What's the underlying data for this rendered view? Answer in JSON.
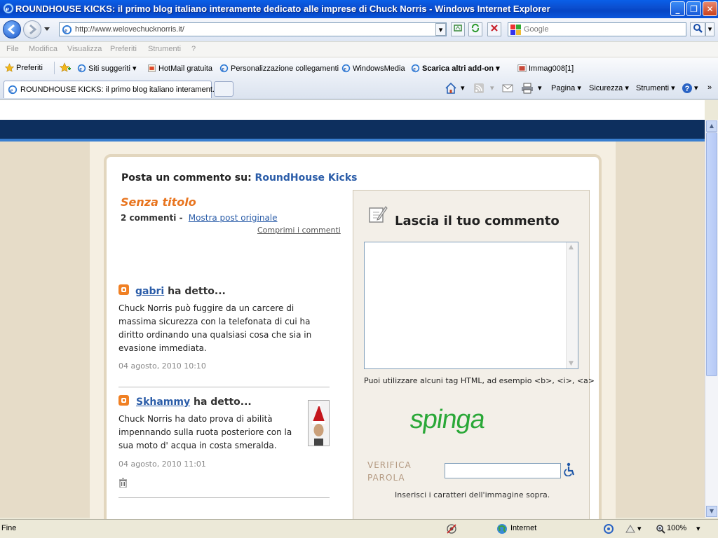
{
  "window": {
    "title": "ROUNDHOUSE KICKS: il primo blog italiano interamente dedicato alle imprese di Chuck Norris - Windows Internet Explorer",
    "minimize": "_",
    "maximize": "❐",
    "close": "✕"
  },
  "address": {
    "url": "http://www.welovechucknorris.it/",
    "search_placeholder": "Google"
  },
  "menu": [
    "File",
    "Modifica",
    "Visualizza",
    "Preferiti",
    "Strumenti",
    "?"
  ],
  "favorites": {
    "label": "Preferiti",
    "items": [
      "Siti suggeriti",
      "HotMail gratuita",
      "Personalizzazione collegamenti",
      "WindowsMedia",
      "Scarica altri add-on",
      "Immag008[1]"
    ]
  },
  "tab": {
    "title": "ROUNDHOUSE KICKS: il primo blog italiano interament..."
  },
  "commands": [
    "Pagina",
    "Sicurezza",
    "Strumenti"
  ],
  "page": {
    "heading_prefix": "Posta un commento su:",
    "blog_name": "RoundHouse Kicks",
    "post_title": "Senza titolo",
    "comment_count": "2 commenti",
    "count_sep": "-",
    "show_original": "Mostra post originale",
    "collapse": "Comprimi i commenti",
    "said": "ha detto...",
    "comments": [
      {
        "author": "gabri",
        "text": "Chuck Norris può fuggire da un carcere di massima sicurezza con la telefonata di cui ha diritto ordinando una qualsiasi cosa che sia in evasione immediata.",
        "date": "04 agosto, 2010 10:10"
      },
      {
        "author": "Skhammy",
        "text": "Chuck Norris ha dato prova di abilità impennando sulla ruota posteriore con la sua moto d' acqua in costa smeralda.",
        "date": "04 agosto, 2010 11:01"
      }
    ],
    "leave_comment": "Lascia il tuo commento",
    "html_hint": "Puoi utilizzare alcuni tag HTML, ad esempio <b>, <i>, <a>",
    "captcha_word": "spinga",
    "verify_line1": "VERIFICA",
    "verify_line2": "PAROLA",
    "captcha_hint": "Inserisci i caratteri dell'immagine sopra."
  },
  "status": {
    "left": "Fine",
    "zone": "Internet",
    "zoom": "100%"
  },
  "colors": {
    "accent_orange": "#e8741e",
    "link_blue": "#2a5ca8",
    "captcha_green": "#2aa838",
    "header_navy": "#0d2f5e"
  }
}
